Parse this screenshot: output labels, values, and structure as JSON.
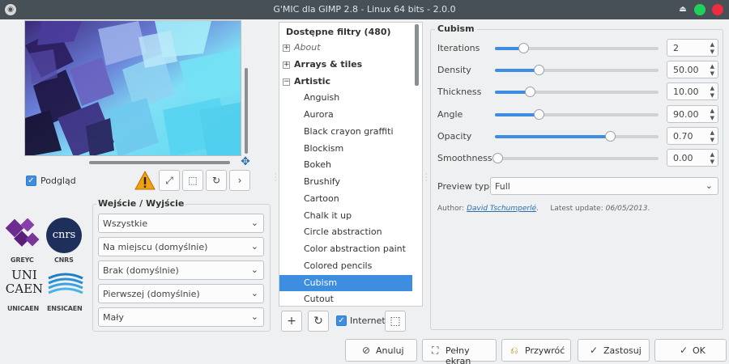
{
  "window": {
    "title": "G'MIC dla GIMP 2.8 - Linux 64 bits - 2.0.0"
  },
  "preview": {
    "checkbox_label": "Podgląd"
  },
  "io": {
    "title": "Wejście / Wyjście",
    "combos": [
      "Wszystkie",
      "Na miejscu (domyślnie)",
      "Brak (domyślnie)",
      "Pierwszej (domyślnie)",
      "Mały"
    ]
  },
  "logos": {
    "greyc": "GREYC",
    "cnrs_mark": "cnrs",
    "cnrs": "CNRS",
    "unicaen_mark": "UNI\nCAEN",
    "unicaen": "UNICAEN",
    "ensicaen": "ENSICAEN"
  },
  "filters": {
    "header": "Dostępne filtry (480)",
    "categories": [
      {
        "label": "About",
        "italic": true
      },
      {
        "label": "Arrays & tiles",
        "bold": true
      },
      {
        "label": "Artistic",
        "bold": true,
        "expanded": true
      }
    ],
    "items": [
      "Anguish",
      "Aurora",
      "Black crayon graffiti",
      "Blockism",
      "Bokeh",
      "Brushify",
      "Cartoon",
      "Chalk it up",
      "Circle abstraction",
      "Color abstraction paint",
      "Colored pencils",
      "Cubism",
      "Cutout"
    ],
    "selected": "Cubism",
    "internet_label": "Internet"
  },
  "params": {
    "title": "Cubism",
    "sliders": [
      {
        "label": "Iterations",
        "value": "2",
        "fraction": 0.16
      },
      {
        "label": "Density",
        "value": "50.00",
        "fraction": 0.25
      },
      {
        "label": "Thickness",
        "value": "10.00",
        "fraction": 0.2
      },
      {
        "label": "Angle",
        "value": "90.00",
        "fraction": 0.25
      },
      {
        "label": "Opacity",
        "value": "0.70",
        "fraction": 0.69
      },
      {
        "label": "Smoothness",
        "value": "0.00",
        "fraction": 0.0
      }
    ],
    "preview_type_label": "Preview type",
    "preview_type_value": "Full",
    "author_prefix": "Author:",
    "author_name": "David Tschumperlé",
    "update_prefix": "Latest update:",
    "update_date": "06/05/2013"
  },
  "buttons": {
    "cancel": "Anuluj",
    "fullscreen": "Pełny ekran",
    "restore": "Przywróć",
    "apply": "Zastosuj",
    "ok": "OK"
  },
  "colors": {
    "accent": "#3d8ee0",
    "titlebar": "#475057",
    "close": "#ee2b3f",
    "maximize": "#1fd05a",
    "warning": "#f0a010"
  }
}
